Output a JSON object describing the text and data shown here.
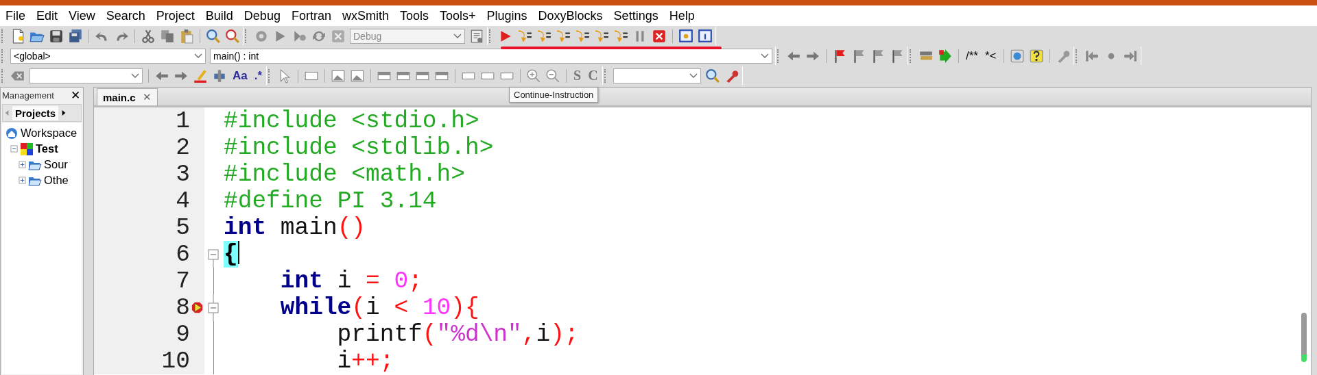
{
  "menu": [
    {
      "label": "File"
    },
    {
      "label": "Edit"
    },
    {
      "label": "View"
    },
    {
      "label": "Search"
    },
    {
      "label": "Project"
    },
    {
      "label": "Build"
    },
    {
      "label": "Debug"
    },
    {
      "label": "Fortran"
    },
    {
      "label": "wxSmith"
    },
    {
      "label": "Tools"
    },
    {
      "label": "Tools+"
    },
    {
      "label": "Plugins"
    },
    {
      "label": "DoxyBlocks"
    },
    {
      "label": "Settings"
    },
    {
      "label": "Help"
    }
  ],
  "toolbar": {
    "build_target": "Debug",
    "scope": "<global>",
    "function": "main() : int",
    "doxy_buttons": [
      "/**",
      "*<"
    ],
    "search_buttons": [
      "Aa",
      ".*"
    ],
    "style_buttons": [
      "S",
      "C"
    ]
  },
  "tooltip": "Continue-Instruction",
  "management": {
    "title": "Management",
    "close": "✕",
    "tabs": [
      {
        "label": "Projects",
        "selected": true
      }
    ],
    "tree": [
      {
        "label": "Workspace",
        "kind": "workspace",
        "children": [
          {
            "label": "Test",
            "kind": "project",
            "expanded": true,
            "children": [
              {
                "label": "Sour",
                "kind": "folder",
                "expanded": false
              },
              {
                "label": "Othe",
                "kind": "folder",
                "expanded": false
              }
            ]
          }
        ]
      }
    ]
  },
  "editor": {
    "tabs": [
      {
        "label": "main.c",
        "close": "✕",
        "selected": true
      }
    ],
    "lines": [
      {
        "number": "1",
        "kind": "plain",
        "breakpoint": false,
        "current": false,
        "caret": false,
        "tokens": [
          {
            "kind": "pre",
            "text": "#include <stdio.h>"
          }
        ]
      },
      {
        "number": "2",
        "kind": "plain",
        "breakpoint": false,
        "current": false,
        "caret": false,
        "tokens": [
          {
            "kind": "pre",
            "text": "#include <stdlib.h>"
          }
        ]
      },
      {
        "number": "3",
        "kind": "plain",
        "breakpoint": false,
        "current": false,
        "caret": false,
        "tokens": [
          {
            "kind": "pre",
            "text": "#include <math.h>"
          }
        ]
      },
      {
        "number": "4",
        "kind": "plain",
        "breakpoint": false,
        "current": false,
        "caret": false,
        "tokens": [
          {
            "kind": "pre",
            "text": "#define PI 3.14"
          }
        ]
      },
      {
        "number": "5",
        "kind": "plain",
        "breakpoint": false,
        "current": false,
        "caret": false,
        "tokens": [
          {
            "kind": "keyword",
            "text": "int"
          },
          {
            "kind": "plain",
            "text": " main"
          },
          {
            "kind": "op",
            "text": "()"
          }
        ]
      },
      {
        "number": "6",
        "kind": "foldstart",
        "breakpoint": false,
        "current": false,
        "caret": true,
        "tokens": [
          {
            "kind": "brace",
            "text": "{"
          }
        ],
        "children": [
          {
            "number": "7",
            "kind": "foldbody",
            "breakpoint": false,
            "current": false,
            "caret": false,
            "tokens": [
              {
                "kind": "keyword",
                "text": "int"
              },
              {
                "kind": "plain",
                "text": " i "
              },
              {
                "kind": "op",
                "text": "= "
              },
              {
                "kind": "number",
                "text": "0"
              },
              {
                "kind": "op",
                "text": ";"
              }
            ]
          },
          {
            "number": "8",
            "kind": "foldstart",
            "breakpoint": true,
            "current": true,
            "caret": false,
            "tokens": [
              {
                "kind": "keyword",
                "text": "while"
              },
              {
                "kind": "op",
                "text": "("
              },
              {
                "kind": "plain",
                "text": "i "
              },
              {
                "kind": "op",
                "text": "< "
              },
              {
                "kind": "number",
                "text": "10"
              },
              {
                "kind": "op",
                "text": "){"
              }
            ],
            "children": [
              {
                "number": "9",
                "kind": "foldbody",
                "breakpoint": false,
                "current": false,
                "caret": false,
                "tokens": [
                  {
                    "kind": "plain",
                    "text": "printf"
                  },
                  {
                    "kind": "op",
                    "text": "("
                  },
                  {
                    "kind": "string",
                    "text": "\"%d\\n\""
                  },
                  {
                    "kind": "op",
                    "text": ","
                  },
                  {
                    "kind": "plain",
                    "text": "i"
                  },
                  {
                    "kind": "op",
                    "text": ");"
                  }
                ]
              },
              {
                "number": "10",
                "kind": "foldbody",
                "breakpoint": false,
                "current": false,
                "caret": false,
                "tokens": [
                  {
                    "kind": "plain",
                    "text": "i"
                  },
                  {
                    "kind": "op",
                    "text": "++;"
                  }
                ]
              }
            ]
          }
        ]
      }
    ]
  }
}
